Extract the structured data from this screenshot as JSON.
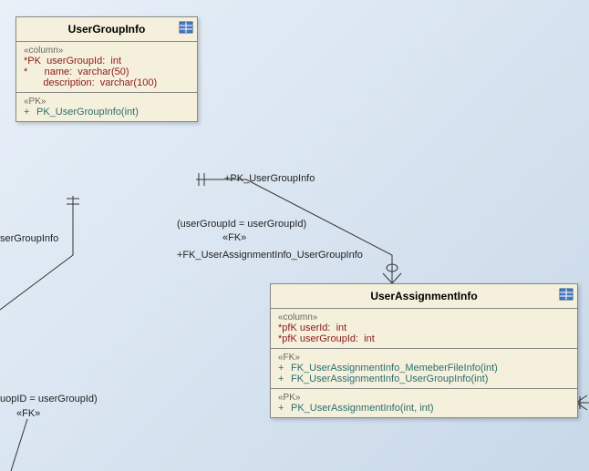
{
  "entities": {
    "userGroupInfo": {
      "title": "UserGroupInfo",
      "colStereo": "«column»",
      "columns": [
        "*PK  userGroupId:  int",
        "*      name:  varchar(50)",
        "       description:  varchar(100)"
      ],
      "pkStereo": "«PK»",
      "pkKey": "PK_UserGroupInfo(int)"
    },
    "userAssignmentInfo": {
      "title": "UserAssignmentInfo",
      "colStereo": "«column»",
      "columns": [
        "*pfK userId:  int",
        "*pfK userGroupId:  int"
      ],
      "fkStereo": "«FK»",
      "fkKeys": [
        "FK_UserAssignmentInfo_MemeberFileInfo(int)",
        "FK_UserAssignmentInfo_UserGroupInfo(int)"
      ],
      "pkStereo": "«PK»",
      "pkKey": "PK_UserAssignmentInfo(int, int)"
    }
  },
  "labels": {
    "pkEnd": "+PK_UserGroupInfo",
    "joinCond": "(userGroupId = userGroupId)",
    "fkStereo": "«FK»",
    "fkEnd": "+FK_UserAssignmentInfo_UserGroupInfo",
    "leftPartial": "serGroupInfo",
    "bottomJoin": "uopID = userGroupId)",
    "bottomFk": "«FK»"
  }
}
